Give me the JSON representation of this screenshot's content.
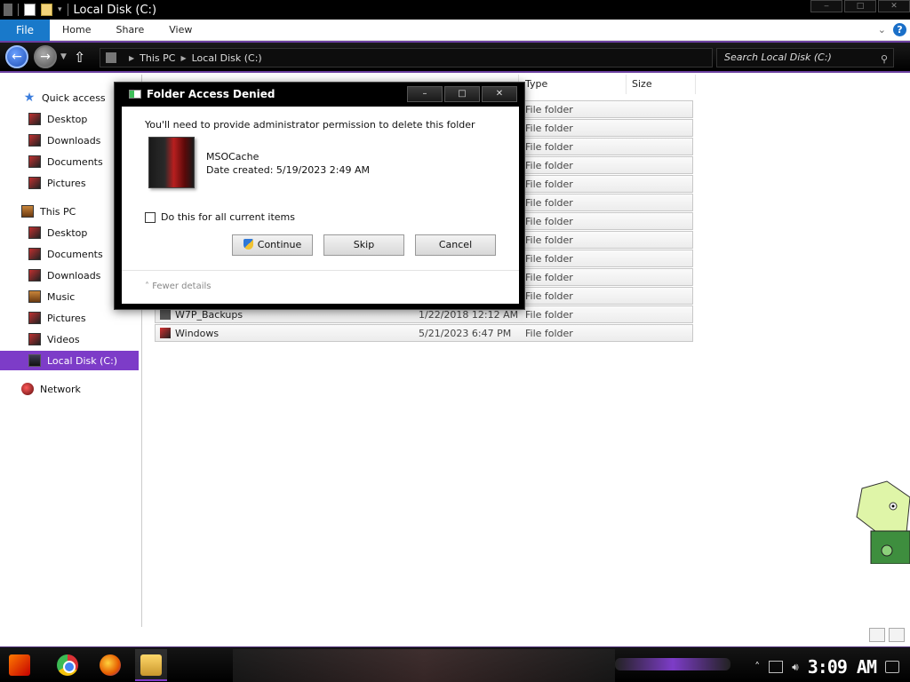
{
  "window": {
    "title": "Local Disk (C:)"
  },
  "ribbon": {
    "tabs": [
      "File",
      "Home",
      "Share",
      "View"
    ],
    "expand_icon": "chevron-down-icon",
    "help_label": "?"
  },
  "address": {
    "crumbs": [
      "This PC",
      "Local Disk (C:)"
    ],
    "search_placeholder": "Search Local Disk (C:)"
  },
  "navpane": {
    "items": [
      {
        "label": "Quick access",
        "icon": "star-icon"
      },
      {
        "label": "Desktop",
        "icon": "desktop-icon"
      },
      {
        "label": "Downloads",
        "icon": "downloads-icon"
      },
      {
        "label": "Documents",
        "icon": "documents-icon"
      },
      {
        "label": "Pictures",
        "icon": "pictures-icon"
      },
      {
        "label": "This PC",
        "icon": "computer-icon"
      },
      {
        "label": "Desktop",
        "icon": "desktop-icon"
      },
      {
        "label": "Documents",
        "icon": "documents-icon"
      },
      {
        "label": "Downloads",
        "icon": "downloads-icon"
      },
      {
        "label": "Music",
        "icon": "music-icon"
      },
      {
        "label": "Pictures",
        "icon": "pictures-icon"
      },
      {
        "label": "Videos",
        "icon": "videos-icon"
      },
      {
        "label": "Local Disk (C:)",
        "icon": "drive-icon",
        "selected": true
      },
      {
        "label": "Network",
        "icon": "network-icon"
      }
    ]
  },
  "filelist": {
    "columns": {
      "type": "Type",
      "size": "Size"
    },
    "rows": [
      {
        "name": "",
        "date": "",
        "type": "File folder"
      },
      {
        "name": "",
        "date": "",
        "type": "File folder"
      },
      {
        "name": "",
        "date": "",
        "type": "File folder"
      },
      {
        "name": "",
        "date": "",
        "type": "File folder"
      },
      {
        "name": "",
        "date": "",
        "type": "File folder"
      },
      {
        "name": "",
        "date": "",
        "type": "File folder"
      },
      {
        "name": "",
        "date": "",
        "type": "File folder"
      },
      {
        "name": "",
        "date": "",
        "type": "File folder"
      },
      {
        "name": "",
        "date": "",
        "type": "File folder"
      },
      {
        "name": "",
        "date": "",
        "type": "File folder"
      },
      {
        "name": "",
        "date": "",
        "type": "File folder"
      },
      {
        "name": "W7P_Backups",
        "date": "1/22/2018 12:12 AM",
        "type": "File folder"
      },
      {
        "name": "Windows",
        "date": "5/21/2023 6:47 PM",
        "type": "File folder"
      }
    ]
  },
  "dialog": {
    "title": "Folder Access Denied",
    "message": "You'll need to provide administrator permission to delete this folder",
    "folder_name": "MSOCache",
    "date_created": "Date created: 5/19/2023 2:49 AM",
    "checkbox_label": "Do this for all current items",
    "checkbox_checked": false,
    "buttons": {
      "continue": "Continue",
      "skip": "Skip",
      "cancel": "Cancel"
    },
    "fewer_details": "Fewer details"
  },
  "taskbar": {
    "clock": "3:09 AM",
    "pinned": [
      "start-icon",
      "chrome-icon",
      "firefox-icon",
      "file-explorer-icon"
    ]
  },
  "colors": {
    "accent": "#7d3cc8",
    "file_tab": "#1979ca"
  }
}
